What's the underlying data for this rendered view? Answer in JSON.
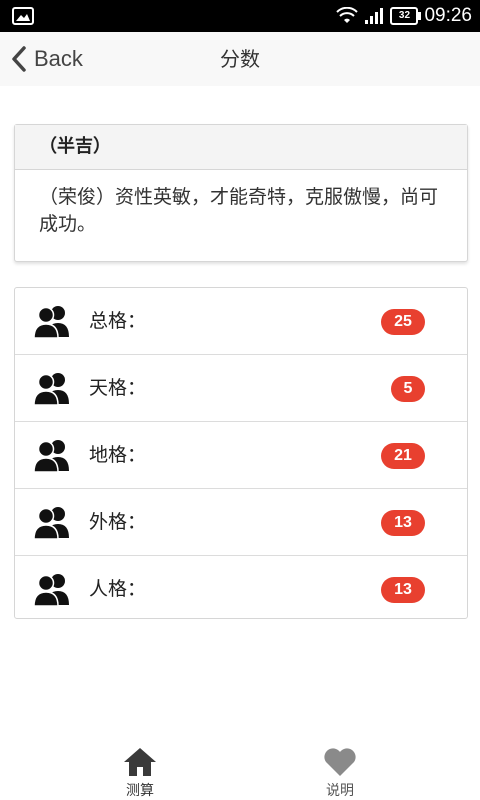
{
  "status_bar": {
    "time": "09:26",
    "battery": "32",
    "icons": [
      "gallery-icon",
      "wifi-icon",
      "signal-icon",
      "battery-icon"
    ]
  },
  "header": {
    "back_label": "Back",
    "title": "分数"
  },
  "result": {
    "heading": "（半吉）",
    "text": "（荣俊）资性英敏，才能奇特，克服傲慢，尚可成功。"
  },
  "scores": [
    {
      "label": "总格：",
      "value": "25"
    },
    {
      "label": "天格：",
      "value": "5"
    },
    {
      "label": "地格：",
      "value": "21"
    },
    {
      "label": "外格：",
      "value": "13"
    },
    {
      "label": "人格：",
      "value": "13"
    }
  ],
  "bottom_nav": {
    "tabs": [
      {
        "label": "测算",
        "icon": "home-icon"
      },
      {
        "label": "说明",
        "icon": "heart-icon"
      }
    ]
  },
  "colors": {
    "badge": "#e8402f",
    "header_bg": "#f8f8f8",
    "status_bar_bg": "#000000"
  }
}
